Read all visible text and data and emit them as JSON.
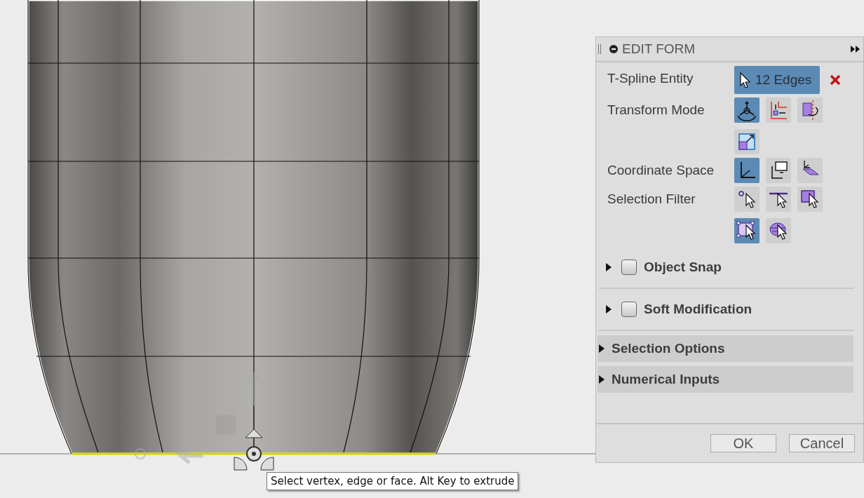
{
  "dialog": {
    "title": "EDIT FORM",
    "rows": [
      {
        "label": "T-Spline Entity",
        "kind": "selection",
        "value": "12 Edges"
      },
      {
        "label": "Transform Mode",
        "kind": "icons",
        "icons": [
          {
            "kind": "multi",
            "selected": true
          },
          {
            "kind": "translate",
            "selected": false
          },
          {
            "kind": "rotate",
            "selected": false
          },
          {
            "kind": "scale",
            "selected": false
          }
        ]
      },
      {
        "label": "Coordinate Space",
        "kind": "icons",
        "icons": [
          {
            "kind": "world",
            "selected": true
          },
          {
            "kind": "view",
            "selected": false
          },
          {
            "kind": "local",
            "selected": false
          }
        ]
      },
      {
        "label": "Selection Filter",
        "kind": "icons",
        "icons": [
          {
            "kind": "vertex",
            "selected": false
          },
          {
            "kind": "edge",
            "selected": false
          },
          {
            "kind": "face",
            "selected": false
          },
          {
            "kind": "all",
            "selected": true
          },
          {
            "kind": "body",
            "selected": false
          }
        ]
      }
    ],
    "sections": [
      {
        "label": "Object Snap",
        "kind": "checkbox",
        "checked": false,
        "expanded": false
      },
      {
        "label": "Soft Modification",
        "kind": "checkbox",
        "checked": false,
        "expanded": false
      },
      {
        "label": "Selection Options",
        "kind": "group",
        "expanded": false
      },
      {
        "label": "Numerical Inputs",
        "kind": "group",
        "expanded": false
      }
    ],
    "buttons": [
      "OK",
      "Cancel"
    ]
  },
  "tooltip": "Select vertex, edge or face. Alt Key to extrude"
}
